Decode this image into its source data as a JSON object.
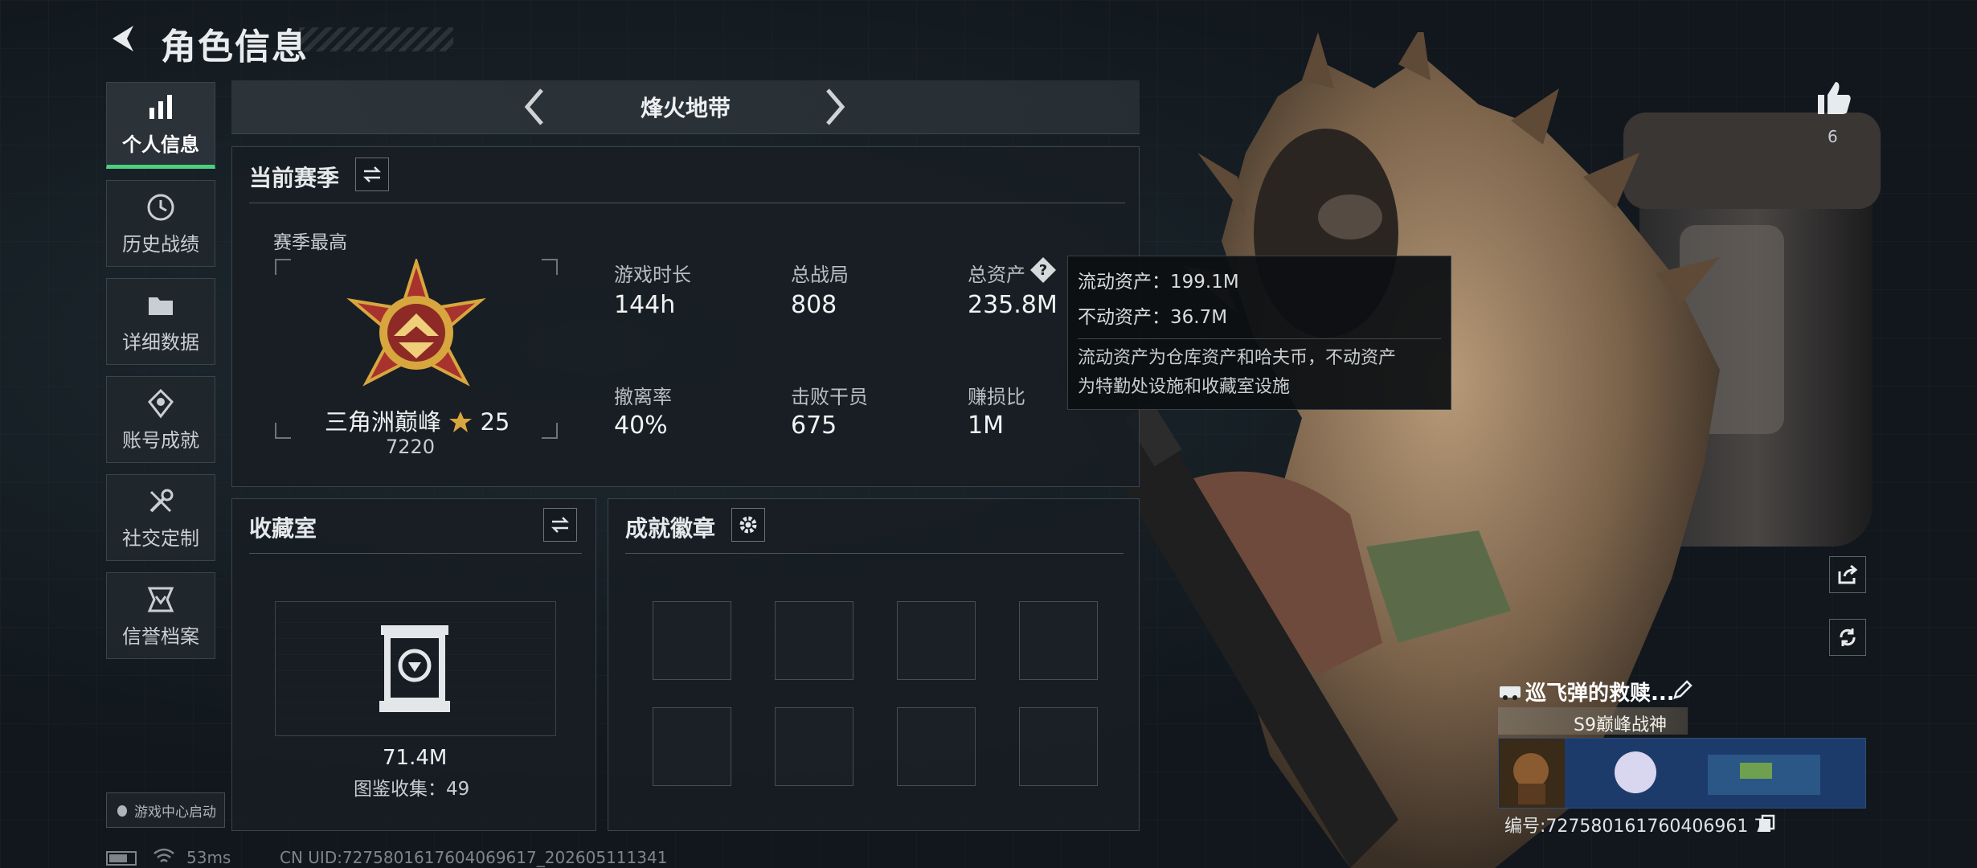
{
  "header": {
    "title": "角色信息"
  },
  "sidebar": {
    "items": [
      {
        "label": "个人信息",
        "icon": "bar-chart-icon"
      },
      {
        "label": "历史战绩",
        "icon": "history-icon"
      },
      {
        "label": "详细数据",
        "icon": "folder-icon"
      },
      {
        "label": "账号成就",
        "icon": "achievement-icon"
      },
      {
        "label": "社交定制",
        "icon": "wrench-icon"
      },
      {
        "label": "信誉档案",
        "icon": "credit-icon"
      }
    ],
    "game_center": "游戏中心启动"
  },
  "mode": {
    "label": "烽火地带"
  },
  "season": {
    "title": "当前赛季",
    "best_label": "赛季最高",
    "rank_name": "三角洲巅峰",
    "rank_stars": "25",
    "rank_points": "7220",
    "stats": [
      {
        "label": "游戏时长",
        "value": "144h"
      },
      {
        "label": "总战局",
        "value": "808"
      },
      {
        "label": "总资产",
        "value": "235.8M"
      },
      {
        "label": "撤离率",
        "value": "40%"
      },
      {
        "label": "击败干员",
        "value": "675"
      },
      {
        "label": "赚损比",
        "value": "1M"
      }
    ]
  },
  "tooltip": {
    "liquid": "流动资产：199.1M",
    "fixed": "不动资产：36.7M",
    "desc_line1": "流动资产为仓库资产和哈夫币，不动资产",
    "desc_line2": "为特勤处设施和收藏室设施"
  },
  "collection": {
    "title": "收藏室",
    "value": "71.4M",
    "catalog": "图鉴收集：49"
  },
  "badges": {
    "title": "成就徽章"
  },
  "likes": {
    "count": "6"
  },
  "player": {
    "name": "巡飞弹的救赎...",
    "title_badge": "S9巅峰战神",
    "uid_label": "编号:727580161760406961 7"
  },
  "status": {
    "ping": "53ms",
    "uid_full": "CN UID:7275801617604069617_202605111341"
  },
  "colors": {
    "accent_green": "#4bd07e",
    "panel_bg": "#181e23",
    "gold": "#d8a63e"
  }
}
